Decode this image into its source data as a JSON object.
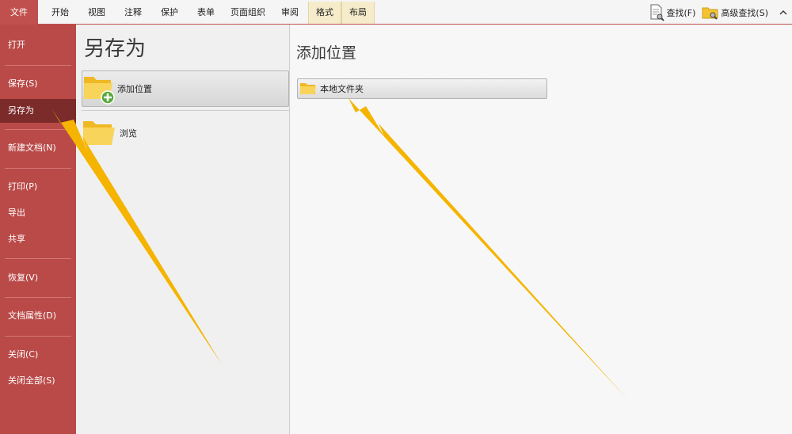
{
  "ribbon": {
    "tabs": [
      {
        "id": "file",
        "label": "文件"
      },
      {
        "id": "start",
        "label": "开始"
      },
      {
        "id": "view",
        "label": "视图"
      },
      {
        "id": "annotate",
        "label": "注释"
      },
      {
        "id": "protect",
        "label": "保护"
      },
      {
        "id": "form",
        "label": "表单"
      },
      {
        "id": "page-org",
        "label": "页面组织"
      },
      {
        "id": "review",
        "label": "审阅"
      },
      {
        "id": "format",
        "label": "格式"
      },
      {
        "id": "layout",
        "label": "布局"
      }
    ],
    "find_label": "查找(F)",
    "advanced_find_label": "高级查找(S)",
    "collapse_glyph": "^"
  },
  "nav": {
    "items": [
      {
        "label": "打开"
      },
      {
        "label": "保存(S)"
      },
      {
        "label": "另存为"
      },
      {
        "label": "新建文档(N)"
      },
      {
        "label": "打印(P)"
      },
      {
        "label": "导出"
      },
      {
        "label": "共享"
      },
      {
        "label": "恢复(V)"
      },
      {
        "label": "文档属性(D)"
      },
      {
        "label": "关闭(C)"
      },
      {
        "label": "关闭全部(S)"
      }
    ],
    "active_index": 2
  },
  "saveas": {
    "title": "另存为",
    "add_location_label": "添加位置",
    "browse_label": "浏览"
  },
  "right": {
    "title": "添加位置",
    "local_folder_label": "本地文件夹"
  },
  "colors": {
    "accent": "#c0504d",
    "nav_bg": "#b94a48",
    "nav_active": "#7b2b2a",
    "arrow": "#f5b400",
    "folder": "#f4c430",
    "plus": "#5aa83c"
  },
  "icons": {
    "find": "document-search-icon",
    "advanced_find": "folder-search-icon",
    "add_location": "folder-plus-icon",
    "browse": "folder-icon",
    "local_folder": "folder-icon"
  }
}
